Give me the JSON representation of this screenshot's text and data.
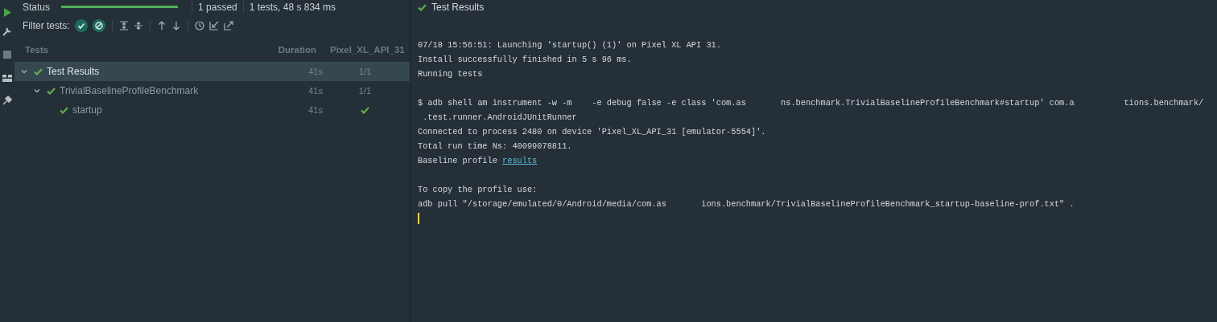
{
  "status": {
    "label": "Status",
    "progress": {
      "level": 1
    },
    "passed": "1 passed",
    "summary": "1 tests, 48 s 834 ms"
  },
  "filter": {
    "label": "Filter tests:",
    "toggles": [
      {
        "kind": "passed",
        "selected": true
      },
      {
        "kind": "ignored",
        "selected": true
      }
    ]
  },
  "columns": [
    "Tests",
    "Duration",
    "Pixel_XL_API_31"
  ],
  "tree": [
    {
      "kind": "suite",
      "name": "Test Results",
      "duration": "41s",
      "result": "1/1",
      "expanded": true,
      "selected": true,
      "children": [
        {
          "kind": "suite",
          "name": "TrivialBaselineProfileBenchmark",
          "duration": "41s",
          "result": "1/1",
          "expanded": true,
          "selected": false,
          "children": [
            {
              "kind": "test",
              "name": "startup",
              "duration": "41s",
              "selected": false
            }
          ]
        }
      ]
    }
  ],
  "console": {
    "title": "Test Results",
    "lines": [
      {
        "kind": "blank"
      },
      {
        "kind": "text",
        "text": "07/18 15:56:51: Launching 'startup() (1)' on Pixel XL API 31."
      },
      {
        "kind": "text",
        "text": "Install successfully finished in 5 s 96 ms."
      },
      {
        "kind": "text",
        "text": "Running tests"
      },
      {
        "kind": "blank"
      },
      {
        "kind": "text",
        "text": "$ adb shell am instrument -w -m    -e debug false -e class 'com.as       ns.benchmark.TrivialBaselineProfileBenchmark#startup' com.a          tions.benchmark/"
      },
      {
        "kind": "text",
        "text": " .test.runner.AndroidJUnitRunner"
      },
      {
        "kind": "text",
        "text": "Connected to process 2480 on device 'Pixel_XL_API_31 [emulator-5554]'."
      },
      {
        "kind": "text",
        "text": "Total run time Ns: 40099078811."
      },
      {
        "kind": "text",
        "text": "Baseline profile ",
        "link": "results"
      },
      {
        "kind": "blank"
      },
      {
        "kind": "text",
        "text": "To copy the profile use:"
      },
      {
        "kind": "text",
        "text": "adb pull \"/storage/emulated/0/Android/media/com.as       ions.benchmark/TrivialBaselineProfileBenchmark_startup-baseline-prof.txt\" ."
      },
      {
        "kind": "cursor"
      }
    ]
  }
}
